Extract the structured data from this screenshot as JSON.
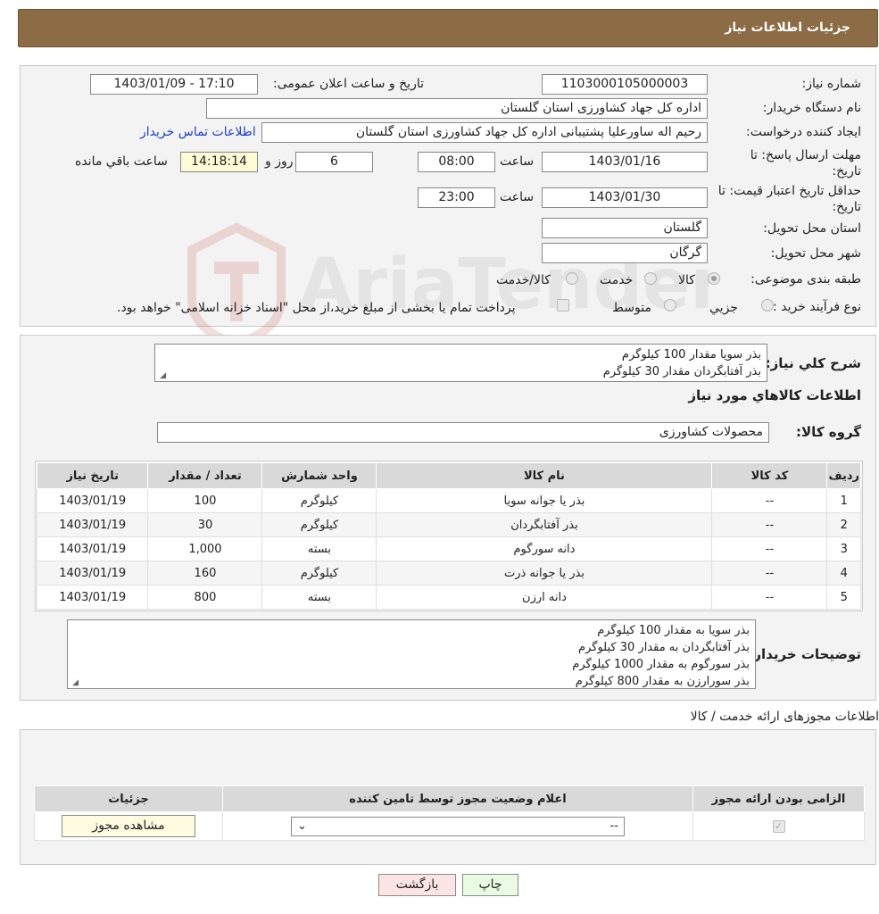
{
  "header": {
    "title": "جزئیات اطلاعات نیاز"
  },
  "form": {
    "need_number_label": "شماره نیاز:",
    "need_number": "1103000105000003",
    "announce_label": "تاریخ و ساعت اعلان عمومی:",
    "announce_value": "1403/01/09 - 17:10",
    "buyer_org_label": "نام دستگاه خریدار:",
    "buyer_org": "اداره کل جهاد کشاورزی استان گلستان",
    "requester_label": "ایجاد کننده درخواست:",
    "requester": "رحیم اله ساورعلیا پشتیبانی اداره کل جهاد کشاورزی استان گلستان",
    "contact_link": "اطلاعات تماس خریدار",
    "deadline_label_1": "مهلت ارسال پاسخ: تا",
    "deadline_label_2": "تاریخ:",
    "deadline_date": "1403/01/16",
    "time_label": "ساعت",
    "deadline_time": "08:00",
    "days_value": "6",
    "days_label": "روز و",
    "remaining_time": "14:18:14",
    "remaining_label": "ساعت باقي مانده",
    "validity_label_1": "حداقل تاریخ اعتبار قیمت: تا",
    "validity_label_2": "تاریخ:",
    "validity_date": "1403/01/30",
    "validity_time": "23:00",
    "province_label": "استان محل تحویل:",
    "province": "گلستان",
    "city_label": "شهر محل تحویل:",
    "city": "گرگان",
    "category_label": "طبقه بندی موضوعی:",
    "category_options": [
      "کالا",
      "خدمت",
      "کالا/خدمت"
    ],
    "process_label": "نوع فرآیند خرید :",
    "process_options": [
      "جزیي",
      "متوسط"
    ],
    "process_note": "پرداخت تمام یا بخشی از مبلغ خرید،از محل \"اسناد خزانه اسلامی\" خواهد بود."
  },
  "description": {
    "label": "شرح کلي نياز:",
    "lines": [
      "بذر سویا مقدار 100 کیلوگرم",
      "بذر آفتابگردان مقدار 30 کیلوگرم"
    ]
  },
  "goods": {
    "section_title": "اطلاعات کالاهاي مورد نياز",
    "group_label": "گروه کالا:",
    "group_value": "محصولات کشاورزی",
    "columns": [
      "رديف",
      "کد کالا",
      "نام کالا",
      "واحد شمارش",
      "تعداد / مقدار",
      "تاريخ نياز"
    ],
    "rows": [
      [
        "1",
        "--",
        "بذر یا جوانه سویا",
        "کیلوگرم",
        "100",
        "1403/01/19"
      ],
      [
        "2",
        "--",
        "بذر آفتابگردان",
        "کیلوگرم",
        "30",
        "1403/01/19"
      ],
      [
        "3",
        "--",
        "دانه سورگوم",
        "بسته",
        "1,000",
        "1403/01/19"
      ],
      [
        "4",
        "--",
        "بذر یا جوانه ذرت",
        "کیلوگرم",
        "160",
        "1403/01/19"
      ],
      [
        "5",
        "--",
        "دانه ارزن",
        "بسته",
        "800",
        "1403/01/19"
      ]
    ]
  },
  "buyer_notes": {
    "label": "توضیحات خریدار:",
    "lines": [
      "بذر سویا به مقدار 100 کیلوگرم",
      "بذر آفتابگردان به مقدار 30 کیلوگرم",
      "بذر سورگوم به مقدار 1000 کیلوگرم",
      "بذر سورارزن به مقدار 800 کیلوگرم"
    ]
  },
  "permits": {
    "section_title": "اطلاعات مجوزهای ارائه خدمت / کالا",
    "columns": [
      "الزامی بودن ارائه مجوز",
      "اعلام وضعیت مجوز توسط تامین کننده",
      "جزئیات"
    ],
    "select_value": "--",
    "view_button": "مشاهده مجوز"
  },
  "actions": {
    "print": "چاپ",
    "back": "بازگشت"
  },
  "watermark_text": "AriaTender.neT",
  "colors": {
    "header": "#8b6c44",
    "link": "#1a3fcf",
    "print_btn": "#e9fbe3",
    "back_btn": "#fde4e4"
  }
}
